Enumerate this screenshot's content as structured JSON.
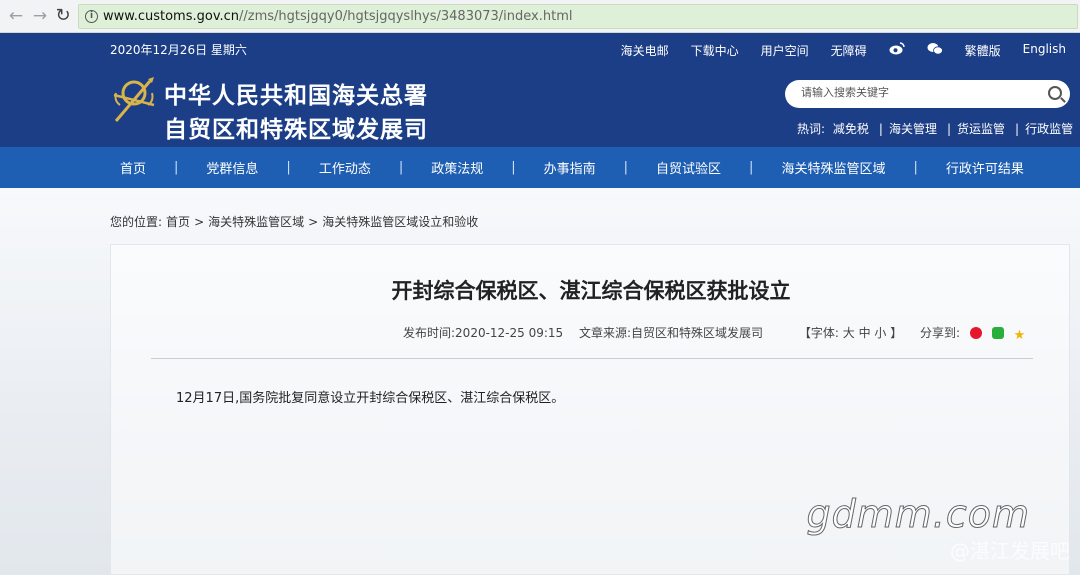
{
  "browser": {
    "url_host": "www.customs.gov.cn",
    "url_path": "//zms/hgtsjgqy0/hgtsjgqyslhys/3483073/index.html"
  },
  "header": {
    "date": "2020年12月26日 星期六",
    "top_links": [
      "海关电邮",
      "下载中心",
      "用户空间",
      "无障碍",
      "繁體版",
      "English"
    ],
    "brand_line1": "中华人民共和国海关总署",
    "brand_line2": "自贸区和特殊区域发展司",
    "search_placeholder": "请输入搜索关键字",
    "hot_label": "热词:",
    "hot_words": [
      "减免税",
      "海关管理",
      "货运监管",
      "行政监管"
    ]
  },
  "nav": {
    "items": [
      "首页",
      "党群信息",
      "工作动态",
      "政策法规",
      "办事指南",
      "自贸试验区",
      "海关特殊监管区域",
      "行政许可结果"
    ]
  },
  "breadcrumb": {
    "label": "您的位置:",
    "items": [
      "首页",
      "海关特殊监管区域",
      "海关特殊监管区域设立和验收"
    ],
    "sep": ">"
  },
  "article": {
    "title": "开封综合保税区、湛江综合保税区获批设立",
    "publish_time": "发布时间:2020-12-25 09:15",
    "source": "文章来源:自贸区和特殊区域发展司",
    "font_size": "【字体: 大 中 小 】",
    "share_label": "分享到:",
    "body": "12月17日,国务院批复同意设立开封综合保税区、湛江综合保税区。"
  },
  "watermark": {
    "text": "gdmm.com",
    "sub": "@湛江发展吧"
  },
  "colors": {
    "header_bg": "#1b3e86",
    "nav_bg": "#1e5eb3",
    "url_bar_bg": "#dff0d8"
  }
}
